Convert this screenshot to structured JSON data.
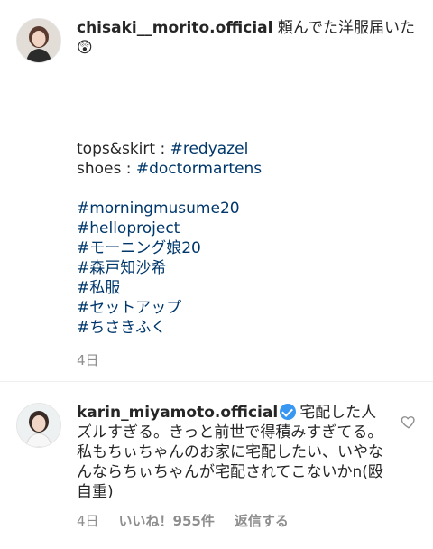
{
  "caption": {
    "username": "chisaki__morito.official",
    "text": " 頼んでた洋服届いた",
    "emoji": "😲",
    "lines": [
      {
        "prefix": "tops&skirt : ",
        "tag": "#redyazel"
      },
      {
        "prefix": "shoes : ",
        "tag": "#doctormartens"
      },
      {
        "prefix": "",
        "tag": ""
      },
      {
        "prefix": "",
        "tag": "#morningmusume20"
      },
      {
        "prefix": "",
        "tag": "#helloproject"
      },
      {
        "prefix": "",
        "tag": "#モーニング娘20"
      },
      {
        "prefix": "",
        "tag": "#森戸知沙希"
      },
      {
        "prefix": "",
        "tag": "#私服"
      },
      {
        "prefix": "",
        "tag": "#セットアップ"
      },
      {
        "prefix": "",
        "tag": "#ちさきふく"
      }
    ],
    "time": "4日"
  },
  "comment": {
    "username": "karin_miyamoto.official",
    "text": "宅配した人ズルすぎる。きっと前世で得積みすぎてる。私もちぃちゃんのお家に宅配したい、いやなんならちぃちゃんが宅配されてこないかn(殴 自重)",
    "time": "4日",
    "likes": "いいね！955件",
    "reply": "返信する"
  },
  "colors": {
    "hashtag": "#00376b",
    "verified": "#3897f0",
    "muted": "#8e8e8e"
  },
  "icons": {
    "verified": "verified-badge-icon",
    "like": "heart-outline-icon"
  }
}
